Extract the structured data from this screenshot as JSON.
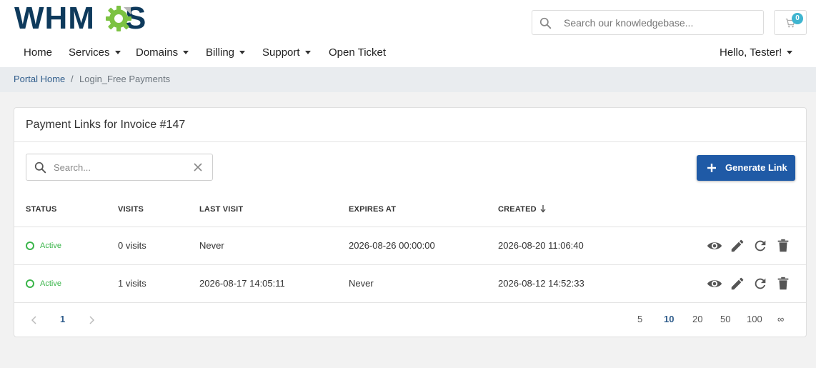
{
  "logo": {
    "text_left": "WHM",
    "text_right": "S",
    "alt": "WHMCS"
  },
  "header": {
    "search_placeholder": "Search our knowledgebase...",
    "cart_count": "0"
  },
  "nav": {
    "items": [
      {
        "label": "Home",
        "dropdown": false
      },
      {
        "label": "Services",
        "dropdown": true
      },
      {
        "label": "Domains",
        "dropdown": true
      },
      {
        "label": "Billing",
        "dropdown": true
      },
      {
        "label": "Support",
        "dropdown": true
      },
      {
        "label": "Open Ticket",
        "dropdown": false
      }
    ],
    "user": "Hello, Tester!"
  },
  "breadcrumb": {
    "home": "Portal Home",
    "separator": "/",
    "current": "Login_Free Payments"
  },
  "card": {
    "title": "Payment Links for Invoice #147",
    "search_placeholder": "Search...",
    "generate_label": "Generate Link",
    "columns": [
      "STATUS",
      "VISITS",
      "LAST VISIT",
      "EXPIRES AT",
      "CREATED"
    ],
    "sorted_column": "CREATED",
    "rows": [
      {
        "status": "Active",
        "visits": "0 visits",
        "last_visit": "Never",
        "expires_at": "2026-08-26 00:00:00",
        "created": "2026-08-20 11:06:40"
      },
      {
        "status": "Active",
        "visits": "1 visits",
        "last_visit": "2026-08-17 14:05:11",
        "expires_at": "Never",
        "created": "2026-08-12 14:52:33"
      }
    ],
    "actions": [
      "view-icon",
      "edit-icon",
      "refresh-icon",
      "delete-icon"
    ]
  },
  "pagination": {
    "current_page": "1",
    "page_sizes": [
      "5",
      "10",
      "20",
      "50",
      "100",
      "∞"
    ],
    "active_page_size": "10"
  },
  "colors": {
    "brand": "#0e3a5c",
    "accent": "#1f5aa6",
    "active_status": "#3ab54a",
    "link": "#305d8c",
    "badge": "#3fb5d0"
  }
}
